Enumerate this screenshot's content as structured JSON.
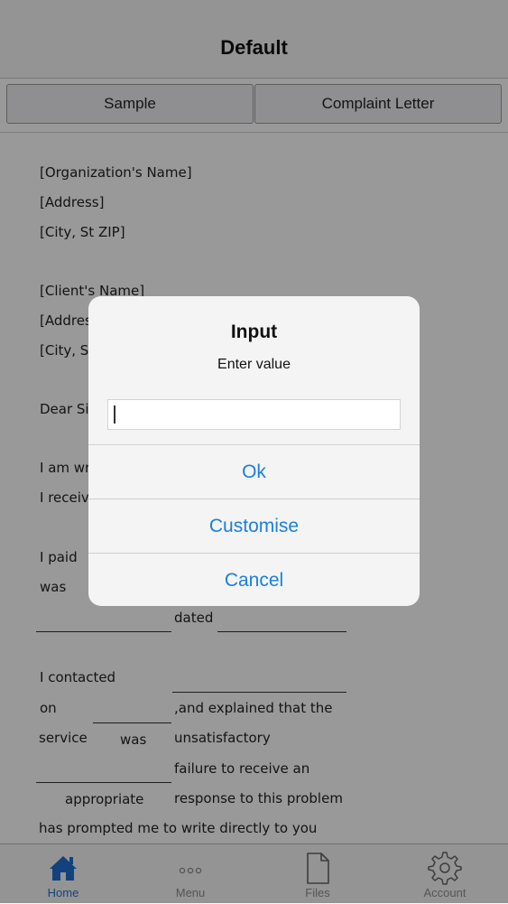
{
  "nav": {
    "title": "Default"
  },
  "segments": [
    {
      "label": "Sample"
    },
    {
      "label": "Complaint Letter"
    }
  ],
  "document": {
    "lines": [
      "[Organization's Name]",
      "[Address]",
      "[City, St ZIP]",
      "[Client's Name]",
      "[Address",
      "[City, St",
      "Dear Si",
      "I am wr",
      "I receiv",
      "I paid",
      "was",
      "dated",
      "I contacted",
      "on",
      ",and explained that the",
      "service",
      "was",
      "unsatisfactory",
      "failure to receive an",
      "appropriate",
      "response to this problem",
      "has prompted me",
      "to write directly to you"
    ]
  },
  "dialog": {
    "title": "Input",
    "message": "Enter value",
    "input_value": "",
    "buttons": [
      "Ok",
      "Customise",
      "Cancel"
    ]
  },
  "tabbar": {
    "active": "home",
    "items": [
      {
        "label": "Home",
        "icon": "home-icon"
      },
      {
        "label": "Menu",
        "icon": "more-dots-icon"
      },
      {
        "label": "Files",
        "icon": "file-icon"
      },
      {
        "label": "Account",
        "icon": "gear-icon"
      }
    ],
    "active_color": "#1f6fd1",
    "inactive_color": "#8e8e93"
  },
  "colors": {
    "accent": "#1a7fe0"
  }
}
